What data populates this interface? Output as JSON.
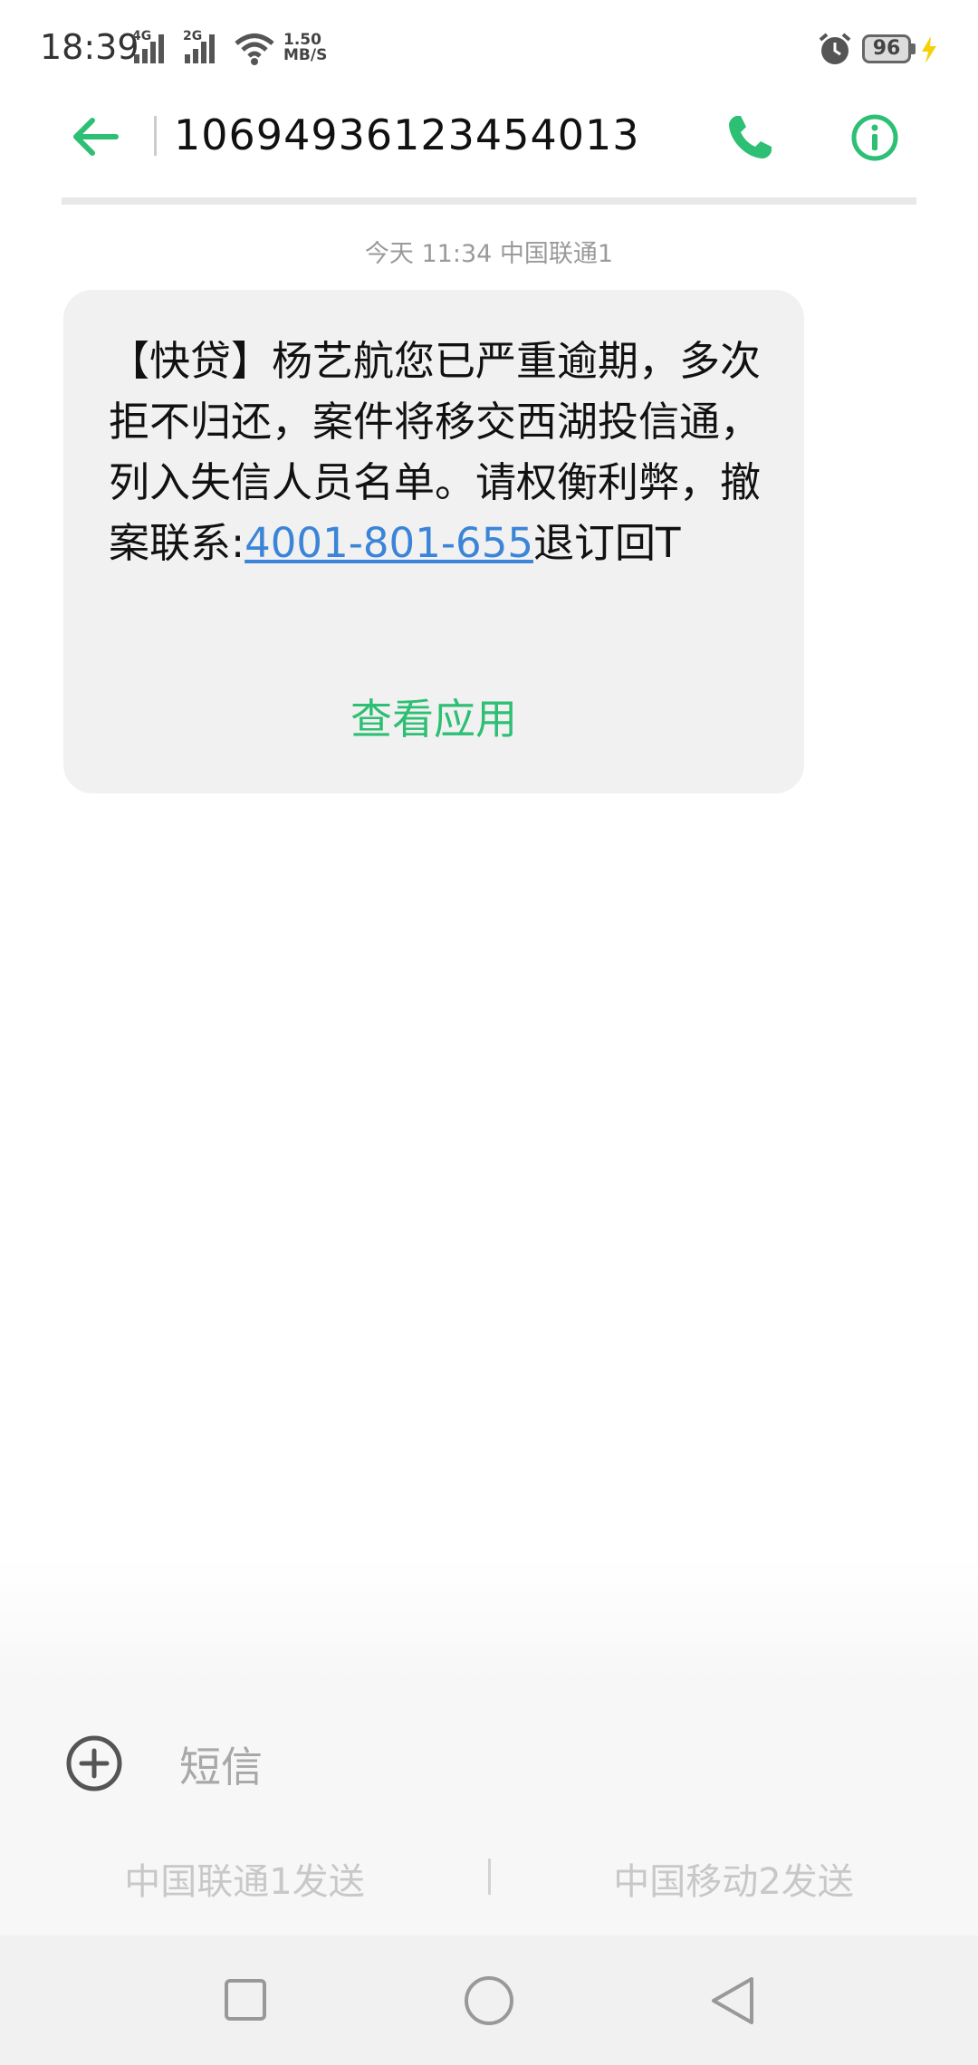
{
  "status_bar": {
    "time": "18:39",
    "sim1_label": "4G",
    "sim2_label": "2G",
    "speed_value": "1.50",
    "speed_unit": "MB/S",
    "battery": "96"
  },
  "header": {
    "title": "10694936123454013"
  },
  "conversation": {
    "timestamp": "今天 11:34  中国联通1",
    "message": {
      "text_before_link": "【快贷】杨艺航您已严重逾期，多次拒不归还，案件将移交西湖投信通，列入失信人员名单。请权衡利弊，撤案联系:",
      "link": "4001-801-655",
      "text_after_link": "退订回T",
      "action_label": "查看应用"
    }
  },
  "composer": {
    "placeholder": "短信",
    "send_sim1": "中国联通1发送",
    "send_sim2": "中国移动2发送"
  },
  "colors": {
    "accent": "#2dbf73",
    "link": "#3b84d8",
    "bubble": "#f1f1f1",
    "charging": "#f5d10a"
  },
  "icons": {
    "back": "arrow-left-icon",
    "call": "phone-icon",
    "info": "info-icon",
    "add": "plus-circle-icon",
    "alarm": "alarm-icon",
    "wifi": "wifi-icon",
    "charging": "bolt-icon",
    "nav_recent": "square-icon",
    "nav_home": "circle-icon",
    "nav_back": "triangle-back-icon"
  }
}
